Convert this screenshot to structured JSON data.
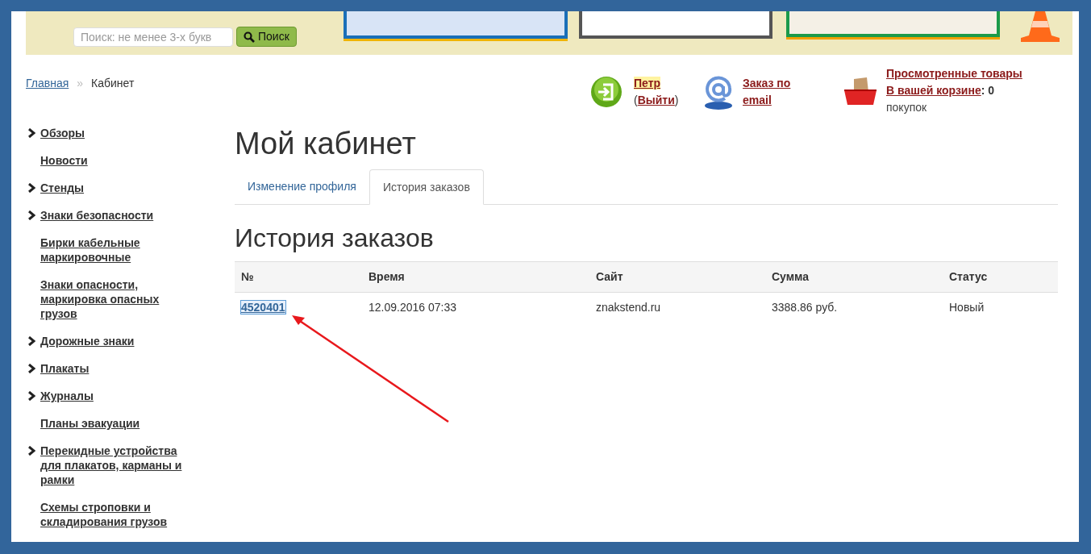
{
  "search": {
    "placeholder": "Поиск: не менее 3-х букв",
    "button": "Поиск"
  },
  "breadcrumbs": [
    {
      "label": "Главная",
      "kind": "link"
    },
    {
      "label": "»",
      "kind": "separator"
    },
    {
      "label": "Кабинет",
      "kind": "current"
    }
  ],
  "user": {
    "name": "Петр",
    "open_paren": "(",
    "logout": "Выйти",
    "close_paren": ")"
  },
  "email_order": "Заказ по email",
  "cart": {
    "viewed": "Просмотренные товары",
    "in_cart": "В вашей корзине",
    "colon": ":",
    "count": "0",
    "unit": "покупок"
  },
  "sidebar": {
    "items": [
      {
        "label": "Обзоры",
        "expandable": true
      },
      {
        "label": "Новости",
        "expandable": false
      },
      {
        "label": "Стенды",
        "expandable": true
      },
      {
        "label": "Знаки безопасности",
        "expandable": true
      },
      {
        "label": "Бирки кабельные маркировочные",
        "expandable": false
      },
      {
        "label": "Знаки опасности, маркировка опасных грузов",
        "expandable": false
      },
      {
        "label": "Дорожные знаки",
        "expandable": true
      },
      {
        "label": "Плакаты",
        "expandable": true
      },
      {
        "label": "Журналы",
        "expandable": true
      },
      {
        "label": "Планы эвакуации",
        "expandable": false
      },
      {
        "label": "Перекидные устройства для плакатов, карманы и рамки",
        "expandable": true
      },
      {
        "label": "Схемы строповки и складирования грузов",
        "expandable": false
      }
    ]
  },
  "page_title": "Мой кабинет",
  "tabs": [
    {
      "label": "Изменение профиля",
      "selected": false
    },
    {
      "label": "История заказов",
      "selected": true
    }
  ],
  "section_title": "История заказов",
  "table": {
    "columns": [
      "№",
      "Время",
      "Сайт",
      "Сумма",
      "Статус"
    ],
    "rows": [
      {
        "cells": [
          {
            "kind": "link",
            "text": "4520401",
            "focused": true
          },
          {
            "kind": "text",
            "text": "12.09.2016 07:33"
          },
          {
            "kind": "text",
            "text": "znakstend.ru"
          },
          {
            "kind": "text",
            "text": "3388.86 руб."
          },
          {
            "kind": "text",
            "text": "Новый"
          }
        ]
      }
    ]
  }
}
